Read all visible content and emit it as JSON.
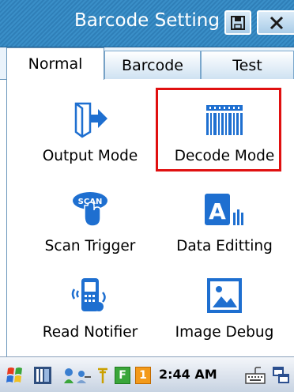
{
  "window": {
    "title": "Barcode Setting"
  },
  "tabs": [
    {
      "label": "Normal",
      "active": true
    },
    {
      "label": "Barcode",
      "active": false
    },
    {
      "label": "Test",
      "active": false
    }
  ],
  "items": {
    "output_mode": {
      "label": "Output Mode",
      "icon": "output-door-arrow-icon"
    },
    "decode_mode": {
      "label": "Decode Mode",
      "icon": "barcode-icon",
      "highlighted": true
    },
    "scan_trigger": {
      "label": "Scan Trigger",
      "icon": "scan-trigger-hand-icon"
    },
    "data_editing": {
      "label": "Data Editting",
      "icon": "data-edit-a-icon"
    },
    "read_notifier": {
      "label": "Read Notifier",
      "icon": "phone-sound-icon"
    },
    "image_debug": {
      "label": "Image Debug",
      "icon": "image-picture-icon"
    }
  },
  "taskbar": {
    "time": "2:44 AM",
    "badge_f": "F",
    "badge_1": "1"
  },
  "colors": {
    "titlebar": "#2f7fb8",
    "accent_blue": "#1e6fd0",
    "highlight_red": "#e01010"
  }
}
